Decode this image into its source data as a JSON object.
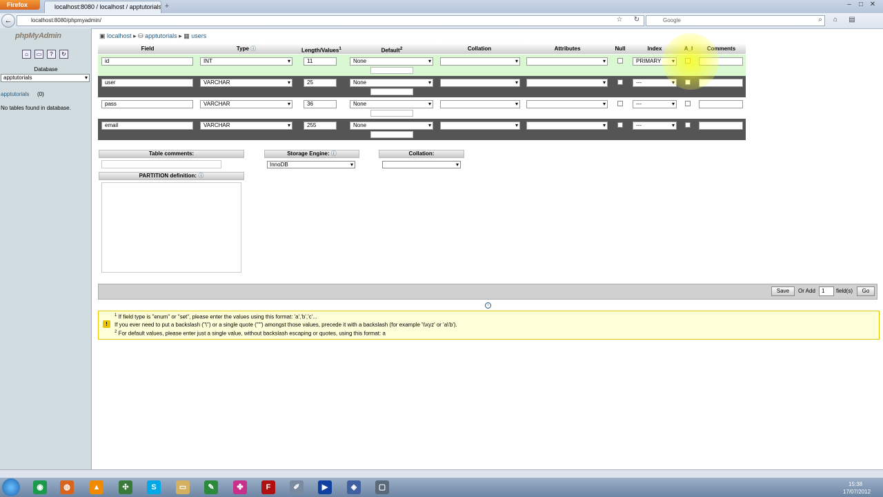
{
  "browser": {
    "app_button": "Firefox",
    "tab_title": "localhost:8080 / localhost / apptutorials ...",
    "url": "localhost:8080/phpmyadmin/",
    "search_placeholder": "Google"
  },
  "sidebar": {
    "logo": "phpMyAdmin",
    "database_label": "Database",
    "database_selected": "apptutorials",
    "db_link": "apptutorials",
    "db_count": "(0)",
    "no_tables": "No tables found in database."
  },
  "breadcrumb": {
    "server": "localhost",
    "database": "apptutorials",
    "table": "users"
  },
  "columns": {
    "field": "Field",
    "type": "Type",
    "length": "Length/Values",
    "length_sup": "1",
    "default": "Default",
    "default_sup": "2",
    "collation": "Collation",
    "attributes": "Attributes",
    "null": "Null",
    "index": "Index",
    "ai": "A_I",
    "comments": "Comments"
  },
  "rows": [
    {
      "field": "id",
      "type": "INT",
      "length": "11",
      "default": "None",
      "index": "PRIMARY"
    },
    {
      "field": "user",
      "type": "VARCHAR",
      "length": "25",
      "default": "None",
      "index": "---"
    },
    {
      "field": "pass",
      "type": "VARCHAR",
      "length": "36",
      "default": "None",
      "index": "---"
    },
    {
      "field": "email",
      "type": "VARCHAR",
      "length": "255",
      "default": "None",
      "index": "---"
    }
  ],
  "table_options": {
    "comments_label": "Table comments:",
    "engine_label": "Storage Engine:",
    "engine_value": "InnoDB",
    "collation_label": "Collation:",
    "partition_label": "PARTITION definition:"
  },
  "actions": {
    "save": "Save",
    "or_add": "Or Add",
    "add_count": "1",
    "fields": "field(s)",
    "go": "Go"
  },
  "notes": {
    "note1_sup": "1",
    "note1": "If field type is \"enum\" or \"set\", please enter the values using this format: 'a','b','c'...",
    "note1b": "If you ever need to put a backslash (\"\\\") or a single quote (\"'\") amongst those values, precede it with a backslash (for example '\\\\xyz' or 'a\\'b').",
    "note2_sup": "2",
    "note2": "For default values, please enter just a single value, without backslash escaping or quotes, using this format: a"
  },
  "clock": {
    "time": "15:38",
    "date": "17/07/2012"
  },
  "colors": {
    "accent": "#235a81",
    "row_light": "#d9f8d2",
    "row_dark": "#555555",
    "notice_bg": "#ffffd9"
  }
}
